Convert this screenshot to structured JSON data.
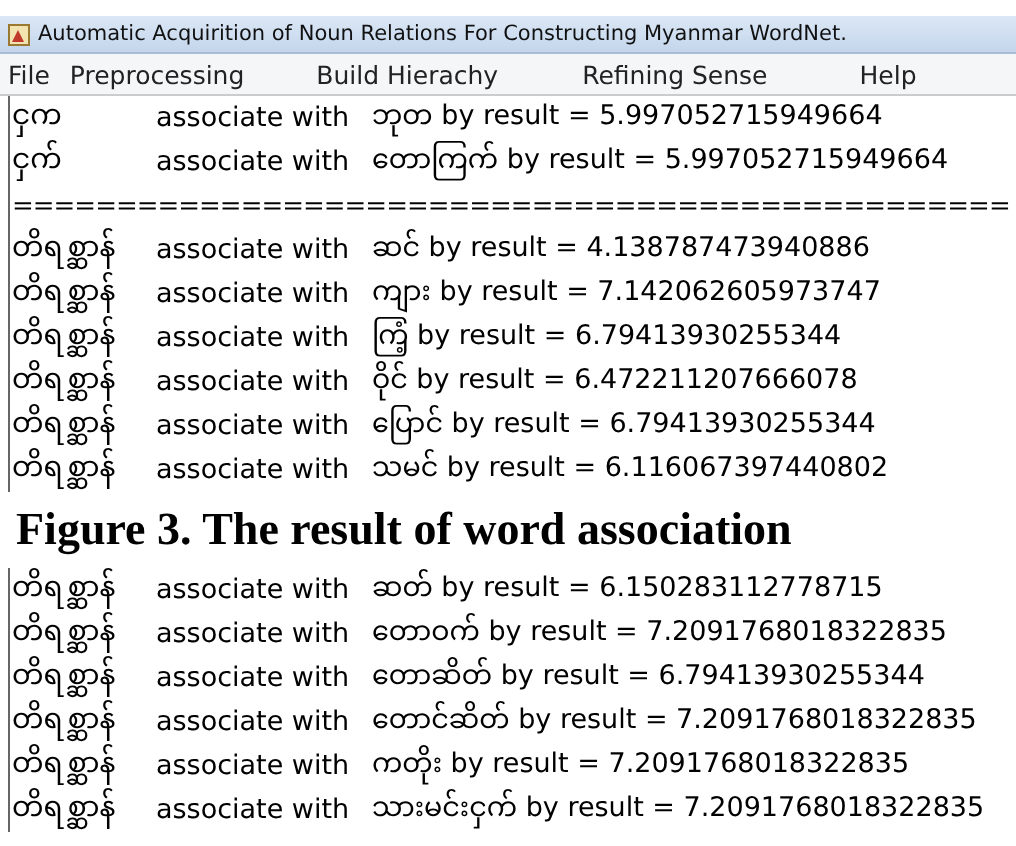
{
  "window": {
    "title": "Automatic Acquirition of Noun Relations For Constructing Myanmar WordNet."
  },
  "menu": [
    {
      "label": "File"
    },
    {
      "label": "Preprocessing"
    },
    {
      "label": "Build Hierachy"
    },
    {
      "label": "Refining Sense"
    },
    {
      "label": "Help"
    }
  ],
  "output_top": {
    "lines": [
      {
        "kind": "result",
        "word": "ငှက",
        "relation": "associate with",
        "result": "ဘုတ by result = 5.997052715949664"
      },
      {
        "kind": "result",
        "word": "ငှက်",
        "relation": "associate with",
        "result": "တောကြက် by result = 5.997052715949664"
      },
      {
        "kind": "separator",
        "text": "================================================"
      },
      {
        "kind": "result",
        "word": "တိရစ္ဆာန်",
        "relation": "associate with",
        "result": "ဆင် by result = 4.138787473940886"
      },
      {
        "kind": "result",
        "word": "တိရစ္ဆာန်",
        "relation": "associate with",
        "result": "ကျား by result = 7.142062605973747"
      },
      {
        "kind": "result",
        "word": "တိရစ္ဆာန်",
        "relation": "associate with",
        "result": "ကြံ့ by result = 6.79413930255344"
      },
      {
        "kind": "result",
        "word": "တိရစ္ဆာန်",
        "relation": "associate with",
        "result": "ဝိုင် by result = 6.472211207666078"
      },
      {
        "kind": "result",
        "word": "တိရစ္ဆာန်",
        "relation": "associate with",
        "result": "ပြောင် by result = 6.79413930255344"
      },
      {
        "kind": "result",
        "word": "တိရစ္ဆာန်",
        "relation": "associate with",
        "result": "သမင် by result = 6.116067397440802"
      }
    ]
  },
  "caption": {
    "text": "Figure 3. The result of word association"
  },
  "output_bottom": {
    "lines": [
      {
        "kind": "result",
        "word": "တိရစ္ဆာန်",
        "relation": "associate with",
        "result": "ဆတ် by result = 6.150283112778715"
      },
      {
        "kind": "result",
        "word": "တိရစ္ဆာန်",
        "relation": "associate with",
        "result": "တောဝက် by result = 7.2091768018322835"
      },
      {
        "kind": "result",
        "word": "တိရစ္ဆာန်",
        "relation": "associate with",
        "result": "တောဆိတ် by result = 6.79413930255344"
      },
      {
        "kind": "result",
        "word": "တိရစ္ဆာန်",
        "relation": "associate with",
        "result": "တောင်ဆိတ် by result = 7.2091768018322835"
      },
      {
        "kind": "result",
        "word": "တိရစ္ဆာန်",
        "relation": "associate with",
        "result": "ကတိုး by result = 7.2091768018322835"
      },
      {
        "kind": "result",
        "word": "တိရစ္ဆာန်",
        "relation": "associate with",
        "result": "သားမင်းငှက် by result = 7.2091768018322835"
      }
    ]
  }
}
